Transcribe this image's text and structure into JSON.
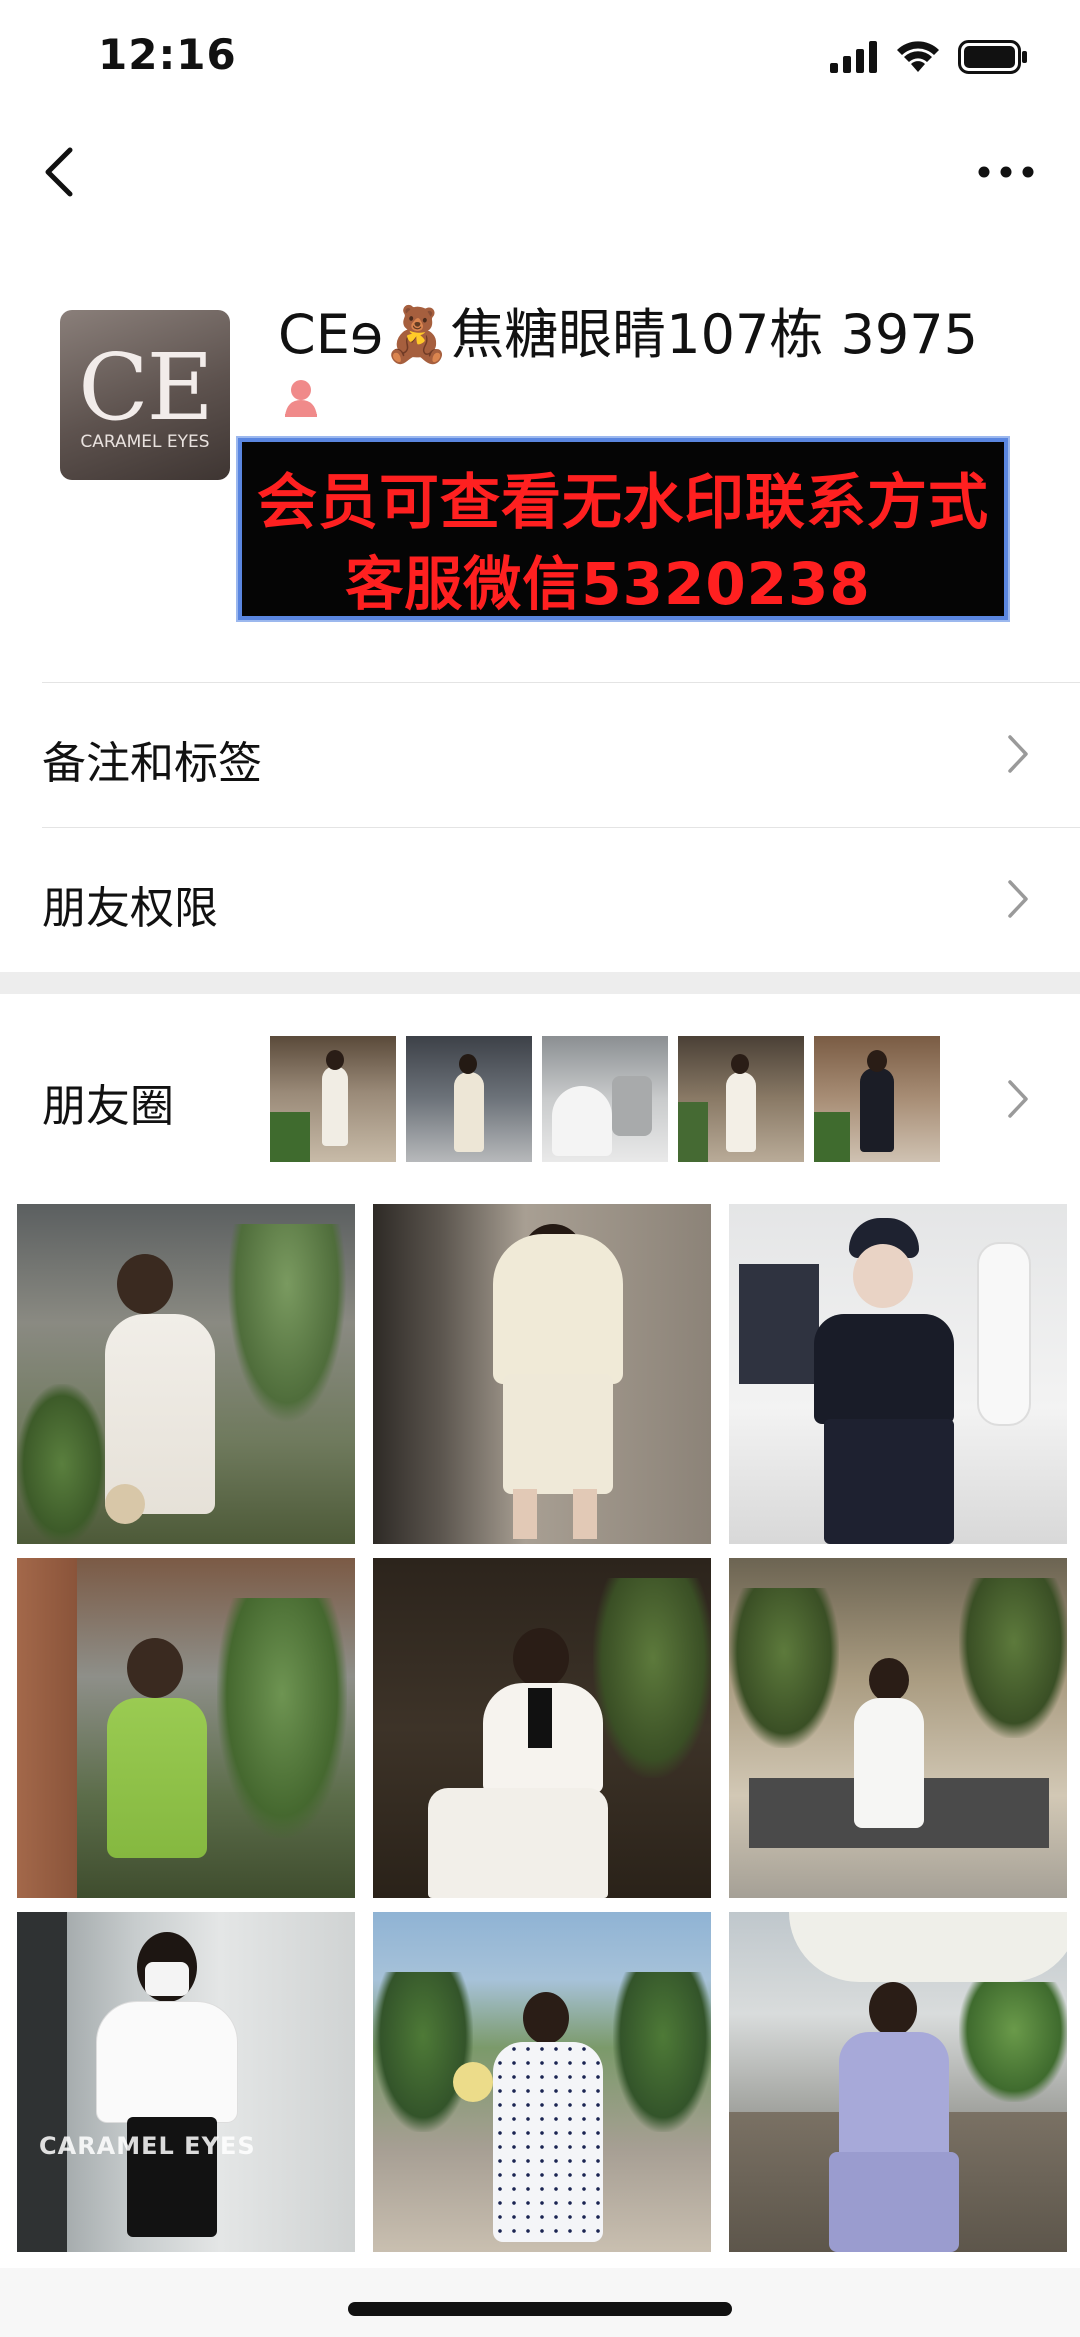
{
  "status_bar": {
    "time": "12:16"
  },
  "profile": {
    "name": "CEɘ🧸焦糖眼睛107栋 3975",
    "avatar_text": "CE",
    "avatar_subtext": "CARAMEL EYES",
    "promo_line1": "会员可查看无水印联系方式",
    "promo_line2": "客服微信5320238"
  },
  "menu": {
    "notes_tags": "备注和标签",
    "friend_permissions": "朋友权限",
    "moments": "朋友圈"
  },
  "watermarks": {
    "caramel_eyes": "CARAMEL EYES"
  },
  "icons": {
    "back": "chevron-left-icon",
    "more": "more-dots-icon",
    "chevron": "chevron-right-icon",
    "user": "user-icon"
  },
  "colors": {
    "promo_text": "#ff2020",
    "promo_bg": "#050505",
    "promo_border": "#5a86e0",
    "user_icon": "#f08a8a"
  }
}
